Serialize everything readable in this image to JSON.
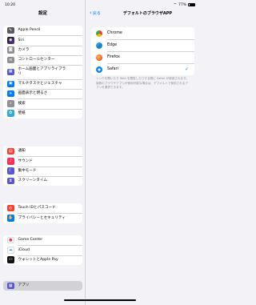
{
  "status": {
    "time": "10:20",
    "battery": "77%"
  },
  "sidebar": {
    "title": "設定",
    "groups": [
      {
        "items": [
          {
            "label": "Apple Pencil",
            "icon": "pencil-icon",
            "color": "#5b5b5f"
          },
          {
            "label": "Siri",
            "icon": "siri-icon",
            "color": "#222"
          },
          {
            "label": "カメラ",
            "icon": "camera-icon",
            "color": "#8e8e93"
          },
          {
            "label": "コントロールセンター",
            "icon": "control-center-icon",
            "color": "#8e8e93"
          },
          {
            "label": "ホーム画面とアプリライブラリ",
            "icon": "home-screen-icon",
            "color": "#5856d6"
          },
          {
            "label": "マルチタスクとジェスチャ",
            "icon": "multitask-icon",
            "color": "#007aff"
          },
          {
            "label": "画面表示と明るさ",
            "icon": "brightness-icon",
            "color": "#007aff"
          },
          {
            "label": "検索",
            "icon": "search-icon",
            "color": "#8e8e93"
          },
          {
            "label": "壁紙",
            "icon": "wallpaper-icon",
            "color": "#34aadc"
          }
        ]
      },
      {
        "items": [
          {
            "label": "通知",
            "icon": "notifications-icon",
            "color": "#ff3b30"
          },
          {
            "label": "サウンド",
            "icon": "sound-icon",
            "color": "#ff2d55"
          },
          {
            "label": "集中モード",
            "icon": "focus-icon",
            "color": "#5856d6"
          },
          {
            "label": "スクリーンタイム",
            "icon": "screen-time-icon",
            "color": "#5856d6"
          }
        ]
      },
      {
        "items": [
          {
            "label": "Touch IDとパスコード",
            "icon": "touch-id-icon",
            "color": "#ff3b30"
          },
          {
            "label": "プライバシーとセキュリティ",
            "icon": "privacy-icon",
            "color": "#007aff"
          }
        ]
      },
      {
        "items": [
          {
            "label": "Game Center",
            "icon": "game-center-icon",
            "color": "#eeeeee"
          },
          {
            "label": "iCloud",
            "icon": "icloud-icon",
            "color": "#eeeeee"
          },
          {
            "label": "ウォレットとApple Pay",
            "icon": "wallet-icon",
            "color": "#111"
          }
        ]
      },
      {
        "items": [
          {
            "label": "アプリ",
            "icon": "apps-icon",
            "color": "#5856d6"
          }
        ]
      }
    ]
  },
  "main": {
    "back_label": "戻る",
    "title": "デフォルトのブラウザAPP",
    "browsers": [
      {
        "label": "Chrome",
        "icon": "chrome-icon",
        "color": "#4285f4",
        "selected": false
      },
      {
        "label": "Edge",
        "icon": "edge-icon",
        "color": "#0f7bd8",
        "selected": false
      },
      {
        "label": "Firefox",
        "icon": "firefox-icon",
        "color": "#ff6a2c",
        "selected": false
      },
      {
        "label": "Safari",
        "icon": "safari-icon",
        "color": "#0a84ff",
        "selected": true
      }
    ],
    "checkmark": "✓",
    "footnote": "リンクを開いたり Web を閲覧したりする際に Safari が使用されます。複数のブラウザアプリが使用可能な場合は、デフォルトで使用されるアプリを選択できます。"
  }
}
